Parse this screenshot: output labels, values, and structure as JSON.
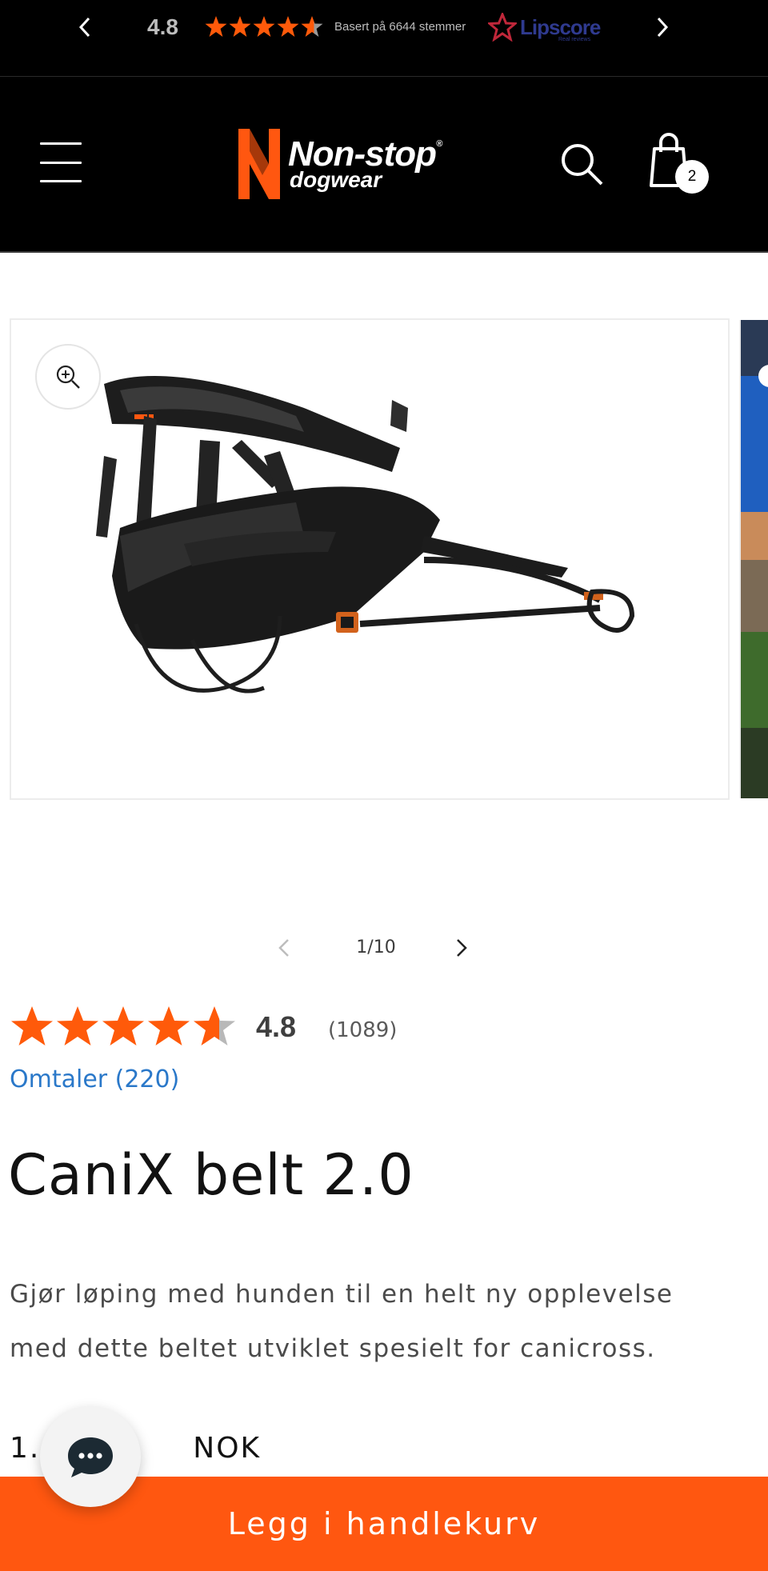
{
  "top_rating_bar": {
    "score": "4.8",
    "rating_fraction": 0.96,
    "based_on": "Basert på 6644 stemmer",
    "provider": "Lipscore",
    "provider_sub": "Real reviews",
    "icons": [
      "chevron-left-icon",
      "star-icon",
      "chevron-right-icon"
    ]
  },
  "header": {
    "brand_line1": "Non-stop",
    "brand_line2": "dogwear",
    "cart_count": "2",
    "icons": [
      "hamburger-menu-icon",
      "search-icon",
      "shopping-bag-icon"
    ]
  },
  "gallery": {
    "counter": "1/10",
    "icons": [
      "zoom-in-icon",
      "chevron-left-icon",
      "chevron-right-icon"
    ]
  },
  "product": {
    "rating_score": "4.8",
    "rating_fraction": 0.96,
    "rating_count": "(1089)",
    "reviews_link": "Omtaler (220)",
    "title": "CaniX belt 2.0",
    "description": "Gjør løping med hunden til en helt ny opplevelse med dette beltet utviklet spesielt for canicross.",
    "price_start": "1.0",
    "price_end": "NOK"
  },
  "actions": {
    "add_to_cart": "Legg i handlekurv",
    "chat_icon": "chat-bubble-icon"
  },
  "colors": {
    "brand_orange": "#ff5710",
    "star_orange": "#ff5a0a",
    "link_blue": "#2a78c9",
    "header_bg": "#000000"
  }
}
